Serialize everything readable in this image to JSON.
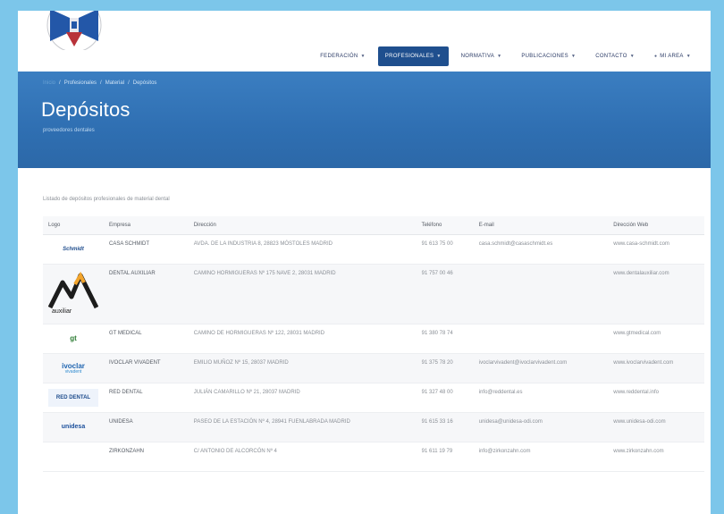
{
  "header": {
    "nav": [
      {
        "label": "FEDERACIÓN",
        "active": false
      },
      {
        "label": "PROFESIONALES",
        "active": true
      },
      {
        "label": "NORMATIVA",
        "active": false
      },
      {
        "label": "PUBLICACIONES",
        "active": false
      },
      {
        "label": "CONTACTO",
        "active": false
      },
      {
        "label": "MI AREA",
        "active": false
      }
    ]
  },
  "banner": {
    "breadcrumbs": [
      "Inicio",
      "Profesionales",
      "Material",
      "Depósitos"
    ],
    "title": "Depósitos",
    "subtitle": "proveedores dentales"
  },
  "intro": "Listado de depósitos profesionales de material dental",
  "table": {
    "headers": [
      "Logo",
      "Empresa",
      "Dirección",
      "Teléfono",
      "E-mail",
      "Dirección Web"
    ],
    "rows": [
      {
        "logo": "casa-schmidt-logo",
        "brand": "Schmidt",
        "company": "CASA SCHMIDT",
        "address": "AVDA. DE LA INDUSTRIA 8, 28823 MÓSTOLES MADRID",
        "phone": "91 613 75 00",
        "email": "casa.schmidt@casaschmidt.es",
        "web": "www.casa-schmidt.com"
      },
      {
        "logo": "dental-auxiliar-logo",
        "brand": "auxiliar",
        "company": "DENTAL AUXILIAR",
        "address": "CAMINO HORMIGUERAS Nº 175 NAVE 2, 28031 MADRID",
        "phone": "91 757 00 46",
        "email": "",
        "web": "www.dentalauxiliar.com"
      },
      {
        "logo": "gt-medical-logo",
        "brand": "gt",
        "company": "GT MEDICAL",
        "address": "CAMINO DE HORMIGUERAS Nº 122, 28031 MADRID",
        "phone": "91 380 78 74",
        "email": "",
        "web": "www.gtmedical.com"
      },
      {
        "logo": "ivoclar-logo",
        "brand": "ivoclar",
        "brand_sub": "vivadent",
        "company": "IVOCLAR VIVADENT",
        "address": "EMILIO MUÑOZ Nº 15, 28037 MADRID",
        "phone": "91 375 78 20",
        "email": "ivoclarvivadent@ivoclarvivadent.com",
        "web": "www.ivoclarvivadent.com"
      },
      {
        "logo": "red-dental-logo",
        "brand": "RED DENTAL",
        "company": "RED DENTAL",
        "address": "JULIÁN CAMARILLO Nº 21, 28037 MADRID",
        "phone": "91 327 48 00",
        "email": "info@reddental.es",
        "web": "www.reddental.info"
      },
      {
        "logo": "unidesa-logo",
        "brand": "unidesa",
        "company": "UNIDESA",
        "address": "PASEO DE LA ESTACIÓN Nº 4, 28941 FUENLABRADA MADRID",
        "phone": "91 615 33 16",
        "email": "unidesa@unidesa-odi.com",
        "web": "www.unidesa-odi.com"
      },
      {
        "logo": "zirkonzahn-logo",
        "brand": "",
        "company": "ZIRKONZAHN",
        "address": "C/ ANTONIO DE ALCORCÓN Nº 4",
        "phone": "91 611 19 79",
        "email": "info@zirkonzahn.com",
        "web": "www.zirkonzahn.com"
      }
    ]
  }
}
